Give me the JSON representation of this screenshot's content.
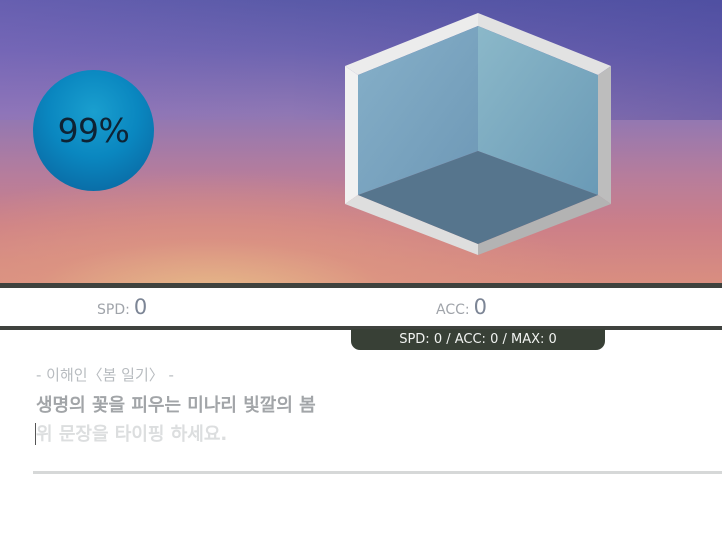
{
  "progress": {
    "label": "99%",
    "value": 0.99
  },
  "cube_icon": "hexagon-box-icon",
  "colors": {
    "sky_top": "#5a5aa8",
    "sky_bottom": "#d98e80",
    "circle": "#0a87c0",
    "bar": "#3f423e",
    "pill": "#384036"
  },
  "stats": {
    "spd_label": "SPD:",
    "spd_value": "0",
    "acc_label": "ACC:",
    "acc_value": "0",
    "summary": "SPD: 0 / ACC: 0 / MAX: 0"
  },
  "typing": {
    "source": "- 이해인〈봄 일기〉 -",
    "sentence": "생명의 꽃을 피우는 미나리 빛깔의 봄",
    "input_value": "",
    "input_placeholder": "위 문장을 타이핑 하세요."
  }
}
